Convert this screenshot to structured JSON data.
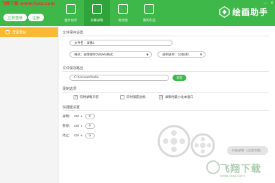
{
  "watermark_top": "飞翔下载 www.fxxz.com",
  "header": {
    "login_label": "立即登录",
    "register_label": "注册",
    "nav_tabs": [
      {
        "label": "图片助手",
        "icon": "image-edit-icon",
        "active": false
      },
      {
        "label": "屏幕录制",
        "icon": "video-camera-icon",
        "active": true
      },
      {
        "label": "找灵感",
        "icon": "lightbulb-icon",
        "active": false
      },
      {
        "label": "我的作品",
        "icon": "gallery-icon",
        "active": false
      }
    ],
    "logo_text": "绘画助手",
    "window_controls": [
      "—",
      "×"
    ]
  },
  "sidebar": {
    "items": [
      {
        "label": "屏幕录制",
        "active": true
      }
    ]
  },
  "file_settings": {
    "title": "文件保存设置",
    "filename": "文件名：录像1",
    "format": "格式：录像保存为WMV格式",
    "bitrate": "录制速率：10帧/秒"
  },
  "save_path": {
    "title": "文件保存路径",
    "path": "C:\\UnicomVedio",
    "browse_label": "浏览"
  },
  "options": {
    "title": "录制选项",
    "items": [
      {
        "label": "同时录制声音",
        "checked": true
      },
      {
        "label": "同时捕获鼠标",
        "checked": false
      },
      {
        "label": "录制时最小化本窗口",
        "checked": true
      }
    ]
  },
  "hotkeys": {
    "title": "快捷键设置",
    "rows": [
      {
        "label": "录制：",
        "combo": "ctrl +",
        "key": "K"
      },
      {
        "label": "暂停：",
        "combo": "ctrl +",
        "key": "P"
      },
      {
        "label": "停止：",
        "combo": "ctrl +",
        "key": "G"
      }
    ]
  },
  "start_button_label": "开始录制（选择范围）",
  "watermark_bottom": "飞翔下载",
  "watermark_bottom_url": "www.fxxz.com",
  "colors": {
    "accent": "#3fb84a",
    "sidebar_active": "#f9b932"
  }
}
